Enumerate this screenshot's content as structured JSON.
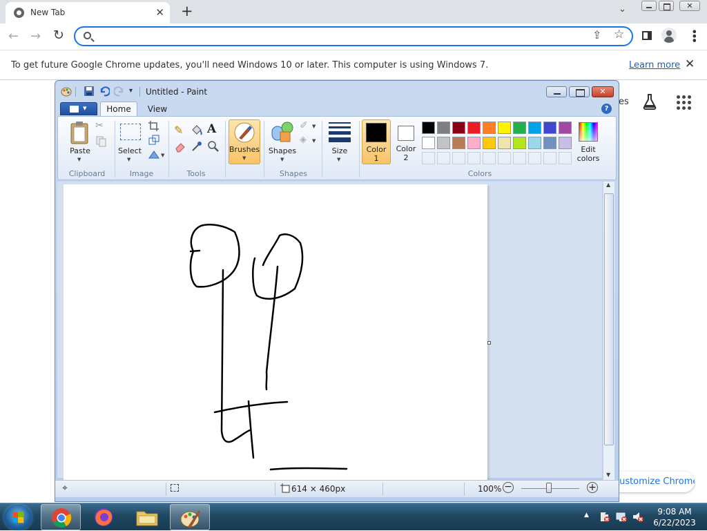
{
  "chrome": {
    "tab_title": "New Tab",
    "omnibox_value": "",
    "infobar_message": "To get future Google Chrome updates, you'll need Windows 10 or later. This computer is using Windows 7.",
    "infobar_link": "Learn more",
    "ntp_shortcut_peek": "es",
    "customize_label": "Customize Chrome",
    "icons": [
      "search-icon",
      "share-icon",
      "star-icon",
      "side-panel-icon",
      "profile-icon",
      "menu-icon",
      "labs-icon",
      "apps-icon"
    ]
  },
  "paint": {
    "title": "Untitled - Paint",
    "tabs": [
      "Home",
      "View"
    ],
    "ribbon": {
      "clipboard": {
        "paste": "Paste",
        "group": "Clipboard"
      },
      "image": {
        "select": "Select",
        "group": "Image"
      },
      "tools": {
        "group": "Tools"
      },
      "brushes": "Brushes",
      "shapes": {
        "shapes": "Shapes",
        "group": "Shapes"
      },
      "size": "Size",
      "color1": {
        "line1": "Color",
        "line2": "1"
      },
      "color2": {
        "line1": "Color",
        "line2": "2"
      },
      "colors_group": "Colors",
      "edit_colors": {
        "line1": "Edit",
        "line2": "colors"
      }
    },
    "palette_row1": [
      "#000000",
      "#7f7f7f",
      "#880015",
      "#ed1c24",
      "#ff7f27",
      "#fff200",
      "#22b14c",
      "#00a2e8",
      "#3f48cc",
      "#a349a4"
    ],
    "palette_row2": [
      "#ffffff",
      "#c3c3c3",
      "#b97a57",
      "#ffaec9",
      "#ffc90e",
      "#efe4b0",
      "#b5e61d",
      "#99d9ea",
      "#7092be",
      "#c8bfe7"
    ],
    "color1_value": "#000000",
    "color2_value": "#ffffff",
    "status": {
      "dimensions": "614 × 460px",
      "zoom": "100%",
      "zoom_level": 1.0
    }
  },
  "taskbar": {
    "apps": [
      "chrome",
      "firefox",
      "file-explorer",
      "paint"
    ],
    "active_apps": [
      "chrome",
      "paint"
    ],
    "time": "9:08 AM",
    "date": "6/22/2023"
  }
}
